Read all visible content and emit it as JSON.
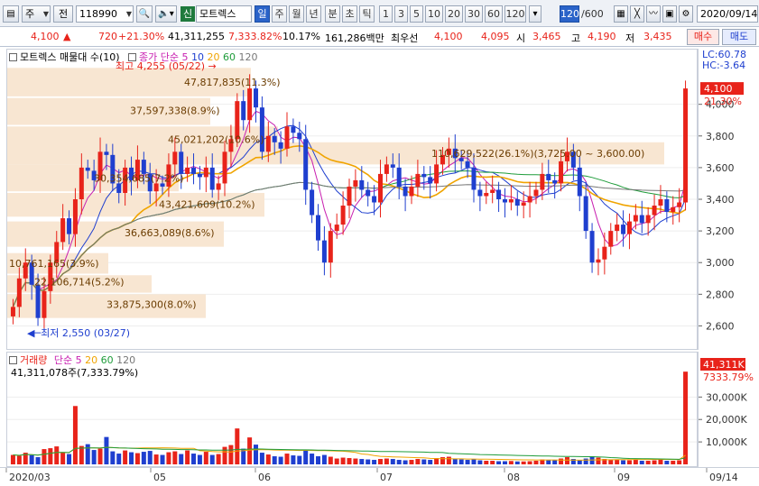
{
  "toolbar": {
    "market_type": "주",
    "period_prefix": "전",
    "code": "118990",
    "badge": "신",
    "name": "모트렉스",
    "segments": [
      "일",
      "주",
      "월",
      "년",
      "분",
      "초",
      "틱"
    ],
    "active_segment": "일",
    "minute_options": [
      "1",
      "3",
      "5",
      "10",
      "20",
      "30",
      "60",
      "120"
    ],
    "count_value": "120",
    "count_total": "/600",
    "date": "2020/09/14"
  },
  "quote": {
    "price": "4,100",
    "change": "720",
    "change_pct": "+21.30%",
    "volume": "41,311,255",
    "vol_pct": "7,333.82%",
    "turnover": "10.17%",
    "amount": "161,286백만",
    "best_label": "최우선",
    "best_ask": "4,100",
    "best_bid": "4,095",
    "open_label": "시",
    "open": "3,465",
    "high_label": "고",
    "high": "4,190",
    "low_label": "저",
    "low": "3,435",
    "buy_label": "매수",
    "sell_label": "매도"
  },
  "price_pane": {
    "legend_title": "모트렉스 매물대 수(10)",
    "ma_label": "종가 단순",
    "ma_periods": [
      "5",
      "10",
      "20",
      "60",
      "120"
    ],
    "lc": "LC:60.78",
    "hc": "HC:-3.64",
    "max_note": "최고 4,255 (05/22)",
    "min_note": "최저 2,550 (03/27)",
    "price_tag": "4,100",
    "pct_tag": "21.30%",
    "y_ticks": [
      "4,000",
      "3,800",
      "3,600",
      "3,400",
      "3,200",
      "3,000",
      "2,800",
      "2,600"
    ],
    "zones": [
      "47,817,835(11.3%)",
      "37,597,338(8.9%)",
      "45,021,202(10.6%)",
      "30,354,685(7.2%)",
      "43,421,609(10.2%)",
      "36,663,089(8.6%)",
      "10,761,165(3.9%)",
      "22,106,714(5.2%)",
      "33,875,300(8.0%)",
      "110,629,522(26.1%)(3,725.00 ~ 3,600.00)"
    ]
  },
  "volume_pane": {
    "legend_title": "거래량",
    "ma_label": "단순",
    "ma_periods": [
      "5",
      "20",
      "60",
      "120"
    ],
    "info": "41,311,078주(7,333.79%)",
    "vol_tag": "41,311K",
    "pct_tag": "7333.79%",
    "y_ticks": [
      "30,000K",
      "20,000K",
      "10,000K"
    ]
  },
  "x_labels": [
    "2020/03",
    "05",
    "06",
    "07",
    "08",
    "09",
    "09/14"
  ],
  "colors": {
    "up": "#e8231a",
    "down": "#1f3fcf",
    "zone": "#f8e6d2",
    "ma5": "#c81fb0",
    "ma10": "#1f3fcf",
    "ma20": "#f0a400",
    "ma60": "#1e9c3a",
    "ma120": "#777777"
  },
  "chart_data": {
    "type": "candlestick",
    "price_ylim": [
      2500,
      4300
    ],
    "volume_ylim": [
      0,
      45000
    ],
    "closes": [
      2720,
      2900,
      3000,
      2860,
      2650,
      2820,
      3000,
      3130,
      3280,
      3180,
      3400,
      3600,
      3580,
      3520,
      3700,
      3680,
      3500,
      3440,
      3600,
      3520,
      3650,
      3560,
      3450,
      3500,
      3480,
      3620,
      3700,
      3560,
      3600,
      3560,
      3540,
      3600,
      3460,
      3500,
      3700,
      3780,
      4020,
      3900,
      4100,
      3980,
      3700,
      3800,
      3760,
      3720,
      3860,
      3820,
      3780,
      3460,
      3300,
      3140,
      3000,
      3200,
      3240,
      3360,
      3480,
      3520,
      3460,
      3420,
      3380,
      3560,
      3620,
      3600,
      3480,
      3420,
      3480,
      3560,
      3540,
      3500,
      3620,
      3680,
      3720,
      3660,
      3640,
      3600,
      3460,
      3420,
      3440,
      3460,
      3400,
      3380,
      3400,
      3360,
      3380,
      3420,
      3460,
      3560,
      3520,
      3500,
      3640,
      3700,
      3600,
      3420,
      3200,
      3000,
      3020,
      3100,
      3200,
      3240,
      3180,
      3260,
      3300,
      3250,
      3300,
      3360,
      3400,
      3320,
      3350,
      3380,
      4100
    ],
    "volumes": [
      4200,
      3800,
      5200,
      4100,
      3200,
      6800,
      7200,
      8000,
      5400,
      4600,
      26000,
      8200,
      9000,
      6400,
      7000,
      12200,
      5800,
      4800,
      6200,
      5400,
      5000,
      5600,
      6000,
      4400,
      4200,
      5400,
      5800,
      4600,
      6200,
      4800,
      4200,
      5600,
      4200,
      4600,
      7800,
      8600,
      16000,
      7000,
      12000,
      8800,
      5200,
      4400,
      3600,
      3400,
      4800,
      4000,
      3800,
      6400,
      4800,
      3600,
      4200,
      3400,
      2600,
      3000,
      2800,
      2600,
      2400,
      2200,
      2000,
      2400,
      2600,
      2400,
      2000,
      1800,
      2000,
      2400,
      2200,
      2000,
      2800,
      3200,
      3400,
      2400,
      2200,
      2000,
      2200,
      1800,
      1600,
      1600,
      1400,
      1400,
      1500,
      1300,
      1300,
      1400,
      1600,
      2200,
      2000,
      1800,
      2600,
      3200,
      2400,
      1800,
      2600,
      3600,
      3000,
      2400,
      2200,
      2000,
      1800,
      1800,
      2000,
      1600,
      1600,
      1800,
      2000,
      1600,
      1600,
      1800,
      41311
    ]
  }
}
